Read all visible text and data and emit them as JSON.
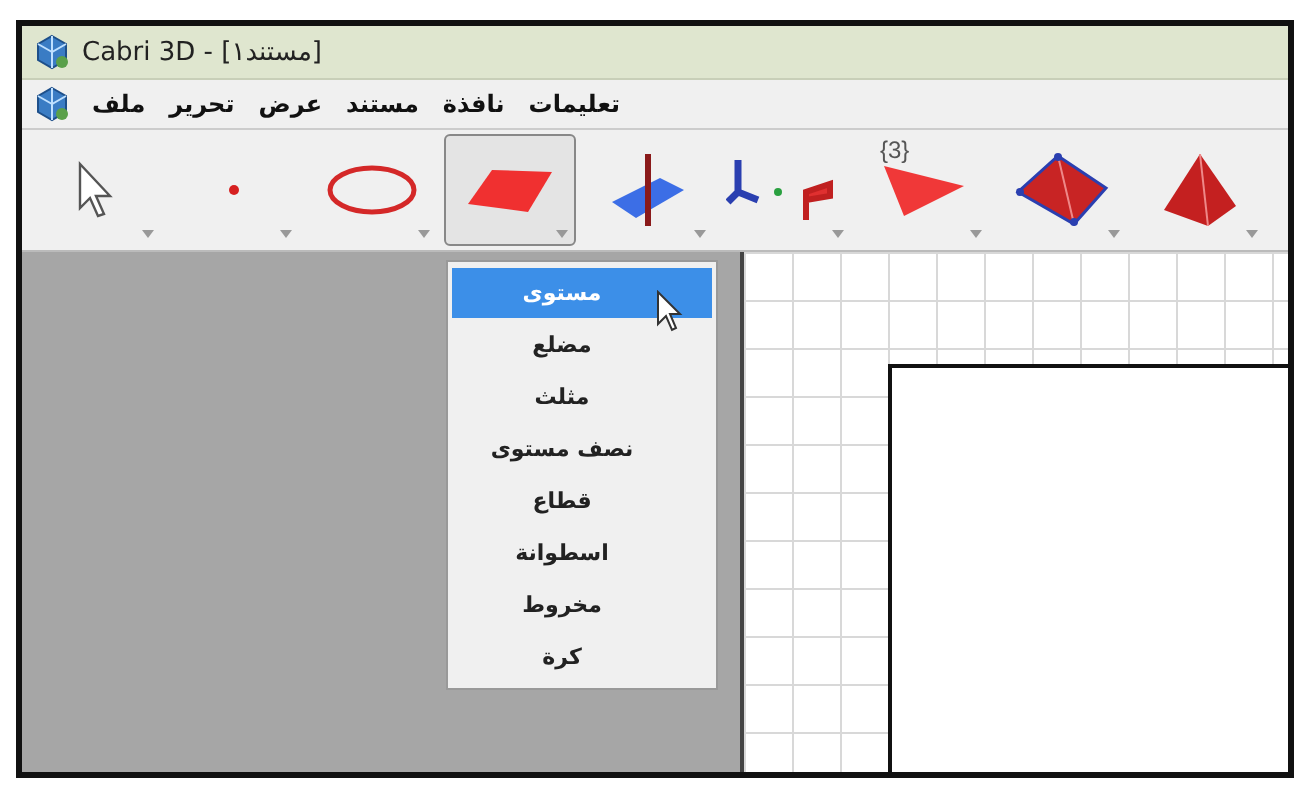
{
  "window": {
    "title": "Cabri 3D - [مستند١]"
  },
  "menu_bar": [
    "تعليمات",
    "نافذة",
    "مستند",
    "عرض",
    "تحرير",
    "ملف"
  ],
  "toolbar": [
    {
      "kind": "pointer",
      "selected": false
    },
    {
      "kind": "point",
      "selected": false
    },
    {
      "kind": "curve",
      "selected": false
    },
    {
      "kind": "plane",
      "selected": true
    },
    {
      "kind": "perpendicular",
      "selected": false
    },
    {
      "kind": "transform",
      "selected": false
    },
    {
      "kind": "polygon",
      "selected": false,
      "label": "{3}"
    },
    {
      "kind": "polyhedron",
      "selected": false
    },
    {
      "kind": "pyramid",
      "selected": false
    }
  ],
  "dropdown": {
    "items": [
      {
        "label": "مستوى",
        "selected": true
      },
      {
        "label": "مضلع",
        "selected": false
      },
      {
        "label": "مثلث",
        "selected": false
      },
      {
        "label": "نصف مستوى",
        "selected": false
      },
      {
        "label": "قطاع",
        "selected": false
      },
      {
        "label": "اسطوانة",
        "selected": false
      },
      {
        "label": "مخروط",
        "selected": false
      },
      {
        "label": "كرة",
        "selected": false
      }
    ]
  }
}
